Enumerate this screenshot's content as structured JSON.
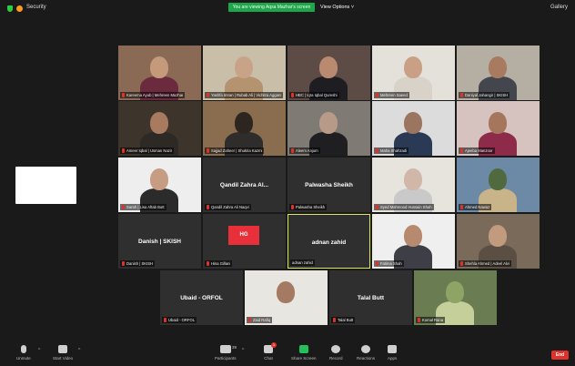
{
  "header": {
    "meeting_title": "Security",
    "speaker_banner": "You are viewing Aqsa Mazhar's screen",
    "view_options": "View Options ˅",
    "gallery_label": "Gallery"
  },
  "tiles": [
    {
      "kind": "video",
      "caption": "Kareema Ayub | Mehreen Mazhar",
      "bg": "#8a6a55",
      "skin": "#c49a7a",
      "cloth": "#6b2a3e"
    },
    {
      "kind": "video",
      "caption": "Yashfa Imran | Rubab Ali | Vichitra Aggarwal",
      "bg": "#c9bfa8",
      "skin": "#c8a387",
      "cloth": "#b6936f"
    },
    {
      "kind": "video",
      "caption": "HBC | Iqra Iqbal Qureshi",
      "bg": "#5c4c45",
      "skin": "#b98a70",
      "cloth": "#1e1e22"
    },
    {
      "kind": "video",
      "caption": "Mehreen Saeed",
      "bg": "#e4e0da",
      "skin": "#c9a085",
      "cloth": "#d9d2c9"
    },
    {
      "kind": "video",
      "caption": "Daniyal Jahangir | SKISH",
      "bg": "#b5aea3",
      "skin": "#a87a5f",
      "cloth": "#44464d"
    },
    {
      "kind": "video",
      "caption": "Ameer Iqbal | Usman Nazir",
      "bg": "#3d342c",
      "skin": "#a87b61",
      "cloth": "#2d2a26"
    },
    {
      "kind": "video",
      "caption": "Sajjad Zaheer | Shukria Kazmi",
      "bg": "#8a6d4f",
      "skin": "#2c2520",
      "cloth": "#2f2d2b"
    },
    {
      "kind": "video",
      "caption": "Aleem Anjum",
      "bg": "#7f7a73",
      "skin": "#b89a88",
      "cloth": "#1f1f21"
    },
    {
      "kind": "video",
      "caption": "Maha Shahzadi",
      "bg": "#dcdcdc",
      "skin": "#9c7560",
      "cloth": "#2a3a55"
    },
    {
      "kind": "video",
      "caption": "Ajeeba Manzoor",
      "bg": "#d6c3c0",
      "skin": "#a5765c",
      "cloth": "#8e2a4a"
    },
    {
      "kind": "video",
      "caption": "Sarah | Lisa Aftab Butt",
      "bg": "#eeeeee",
      "skin": "#c69c82",
      "cloth": "#2b2b2b"
    },
    {
      "kind": "name",
      "name": "Qandil Zahra Al...",
      "caption": "Qandil Zahra Ali Naqvi"
    },
    {
      "kind": "name",
      "name": "Palwasha Sheikh",
      "caption": "Palwasha Sheikh"
    },
    {
      "kind": "video",
      "caption": "Syed Mahmood Hussain Shah",
      "bg": "#e7e4de",
      "skin": "#d0b7a8",
      "cloth": "#c9c9c9"
    },
    {
      "kind": "video",
      "caption": "Ahmed Nawaz",
      "bg": "#6c8aa5",
      "skin": "#4f6a3e",
      "cloth": "#c9b48a"
    },
    {
      "kind": "name",
      "name": "Danish | SKISH",
      "caption": "Danish | SKISH"
    },
    {
      "kind": "brand",
      "logo": "HG",
      "caption": "Hina Gillani"
    },
    {
      "kind": "name",
      "name": "adnan zahid",
      "caption": "adnan zahid",
      "active": true
    },
    {
      "kind": "video",
      "caption": "Fatima Shah",
      "bg": "#efefef",
      "skin": "#b78a70",
      "cloth": "#3e3f46"
    },
    {
      "kind": "video",
      "caption": "Shehla Ahmed | Adeel Alvi",
      "bg": "#7a6a5a",
      "skin": "#c29a7e",
      "cloth": "#5b4f43"
    },
    {
      "kind": "name",
      "name": "Ubaid - ORFOL",
      "caption": "Ubaid - ORFOL"
    },
    {
      "kind": "video",
      "caption": "Zaid Rafiq",
      "bg": "#e8e6e1",
      "skin": "#a47b62",
      "cloth": "#e8e6e1"
    },
    {
      "kind": "name",
      "name": "Talal Butt",
      "caption": "Talal Butt"
    },
    {
      "kind": "video",
      "caption": "Komal Rana",
      "bg": "#6a7d52",
      "skin": "#8da464",
      "cloth": "#c4cf9a"
    }
  ],
  "toolbar": {
    "unmute": "Unmute",
    "start_video": "Start Video",
    "participants": "Participants",
    "participants_count": "39",
    "chat": "Chat",
    "chat_badge": "1",
    "share_screen": "Share Screen",
    "record": "Record",
    "reactions": "Reactions",
    "apps": "Apps",
    "end": "End"
  }
}
